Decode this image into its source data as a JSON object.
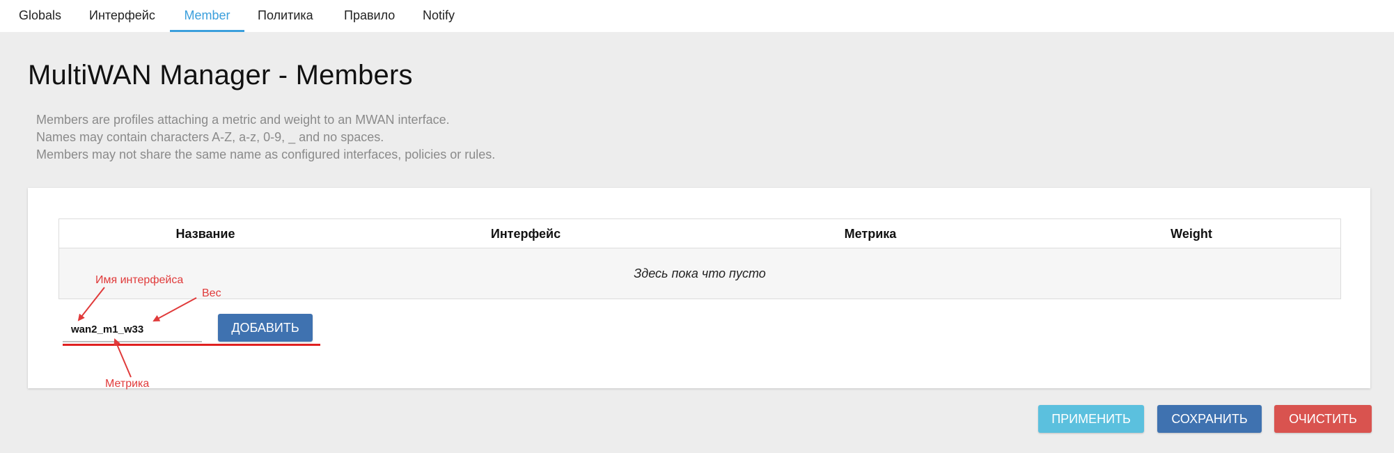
{
  "tabs": [
    {
      "label": "Globals",
      "active": false
    },
    {
      "label": "Интерфейс",
      "active": false
    },
    {
      "label": "Member",
      "active": true
    },
    {
      "label": "Политика",
      "active": false
    },
    {
      "label": "Правило",
      "active": false
    },
    {
      "label": "Notify",
      "active": false
    }
  ],
  "page": {
    "title": "MultiWAN Manager - Members",
    "description": [
      "Members are profiles attaching a metric and weight to an MWAN interface.",
      "Names may contain characters A-Z, a-z, 0-9, _ and no spaces.",
      "Members may not share the same name as configured interfaces, policies or rules."
    ]
  },
  "table": {
    "columns": [
      "Название",
      "Интерфейс",
      "Метрика",
      "Weight"
    ],
    "empty_message": "Здесь пока что пусто"
  },
  "add_form": {
    "name_value": "wan2_m1_w33",
    "add_button": "Добавить"
  },
  "annotations": {
    "interface_name": "Имя интерфейса",
    "weight": "Вес",
    "metric": "Метрика"
  },
  "actions": {
    "apply": "Применить",
    "save": "Сохранить",
    "reset": "Очистить"
  },
  "colors": {
    "accent": "#3b9fdc",
    "primary_button": "#3f72b0",
    "apply_button": "#5bc0de",
    "reset_button": "#d9534f",
    "annotation": "#e03a3a"
  }
}
